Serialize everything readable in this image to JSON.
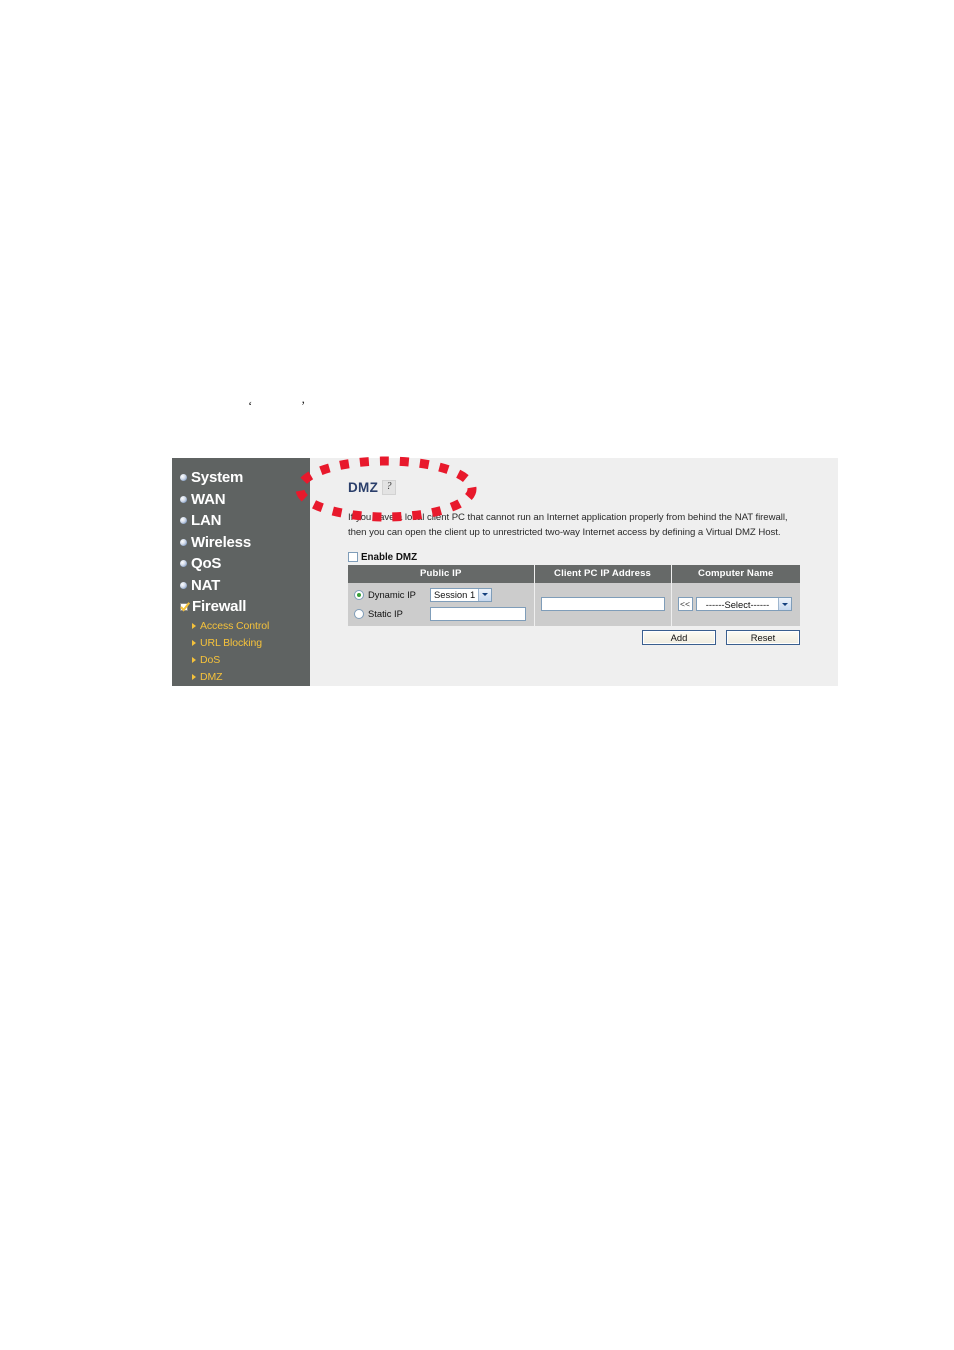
{
  "annotation": {
    "shape": "dashed-ellipse",
    "color": "#e8192c"
  },
  "stray_text": {
    "left_mark": "‘",
    "right_mark": "’"
  },
  "sidebar": {
    "items": [
      {
        "label": "System",
        "icon": "bullet-icon",
        "active": false
      },
      {
        "label": "WAN",
        "icon": "bullet-icon",
        "active": false
      },
      {
        "label": "LAN",
        "icon": "bullet-icon",
        "active": false
      },
      {
        "label": "Wireless",
        "icon": "bullet-icon",
        "active": false
      },
      {
        "label": "QoS",
        "icon": "bullet-icon",
        "active": false
      },
      {
        "label": "NAT",
        "icon": "bullet-icon",
        "active": false
      },
      {
        "label": "Firewall",
        "icon": "check-mark-icon",
        "active": true
      }
    ],
    "subitems": [
      {
        "label": "Access Control",
        "icon": "arrow-right-icon"
      },
      {
        "label": "URL Blocking",
        "icon": "arrow-right-icon"
      },
      {
        "label": "DoS",
        "icon": "arrow-right-icon"
      },
      {
        "label": "DMZ",
        "icon": "arrow-right-icon"
      }
    ],
    "colors": {
      "background": "#5f6362",
      "item_text": "#ffffff",
      "subitem_text": "#f5c23b"
    }
  },
  "main": {
    "title": "DMZ",
    "help_icon_glyph": "?",
    "description": "If you have a local client PC that cannot run an Internet application properly from behind the NAT firewall, then you can open the client up to unrestricted two-way Internet access by defining a Virtual DMZ Host.",
    "enable_checkbox": {
      "label": "Enable DMZ",
      "checked": false
    },
    "table": {
      "headers": [
        "Public IP",
        "Client PC IP Address",
        "Computer Name"
      ],
      "public_ip": {
        "dynamic": {
          "label": "Dynamic IP",
          "selected": true,
          "session_value": "Session 1"
        },
        "static": {
          "label": "Static IP",
          "selected": false,
          "input_value": "",
          "input_placeholder": ""
        }
      },
      "client_pc_ip": {
        "input_value": "",
        "input_placeholder": ""
      },
      "computer_name": {
        "copy_button_label": "<<",
        "select_value": "------Select------"
      }
    },
    "buttons": {
      "add": "Add",
      "reset": "Reset"
    },
    "colors": {
      "page_background": "#efefef",
      "title_text": "#2b3f6b",
      "table_header_bg": "#666968",
      "table_cell_bg": "#cccccc",
      "input_border": "#7f9db9"
    }
  }
}
